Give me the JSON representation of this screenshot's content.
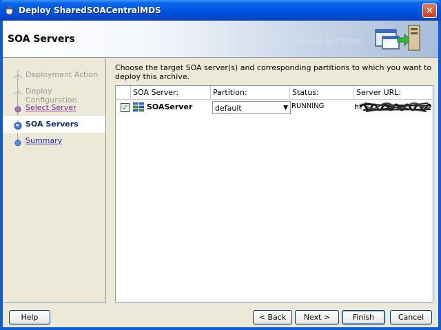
{
  "window": {
    "title": "Deploy SharedSOACentralMDS"
  },
  "header": {
    "title": "SOA Servers",
    "art_text": "010101010101010101 10101010101"
  },
  "nav": {
    "items": [
      {
        "label": "Deployment Action",
        "state": "disabled"
      },
      {
        "label": "Deploy Configuration",
        "state": "disabled"
      },
      {
        "label": "Select Server",
        "state": "visited"
      },
      {
        "label": "SOA Servers",
        "state": "current"
      },
      {
        "label": "Summary",
        "state": "link"
      }
    ]
  },
  "main": {
    "instructions": "Choose the target SOA server(s) and corresponding partitions to which you want to deploy this archive.",
    "table": {
      "columns": [
        "SOA Server:",
        "Partition:",
        "Status:",
        "Server URL:"
      ],
      "rows": [
        {
          "checked": true,
          "server": "SOAServer",
          "partition": "default",
          "status": "RUNNING",
          "url": "ht"
        }
      ]
    }
  },
  "buttons": {
    "help": "Help",
    "back": "< Back",
    "next": "Next >",
    "finish": "Finish",
    "cancel": "Cancel"
  },
  "colors": {
    "titlebar": "#0055e5",
    "accent_link": "#2a2aa8",
    "current_nav": "#0c2a6a"
  }
}
